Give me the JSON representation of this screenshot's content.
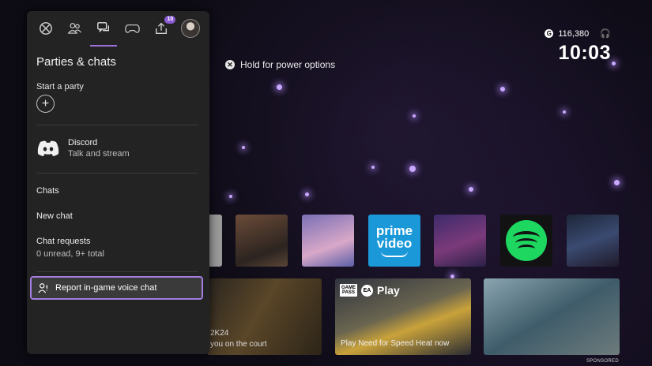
{
  "background": {
    "accent": "#9b6fd9"
  },
  "status": {
    "gamerscore": "116,380",
    "time": "10:03"
  },
  "hints": {
    "power": "Hold for power options"
  },
  "guide": {
    "tabs": [
      {
        "icon": "xbox-icon"
      },
      {
        "icon": "people-icon"
      },
      {
        "icon": "chat-bubbles-icon",
        "active": true
      },
      {
        "icon": "controller-icon"
      },
      {
        "icon": "upload-icon",
        "badge": "10"
      },
      {
        "icon": "profile-avatar"
      }
    ],
    "title": "Parties & chats",
    "start_party_label": "Start a party",
    "discord": {
      "name": "Discord",
      "subtitle": "Talk and stream"
    },
    "chats_label": "Chats",
    "new_chat_label": "New chat",
    "chat_requests": {
      "label": "Chat requests",
      "subtitle": "0 unread, 9+ total"
    },
    "report_label": "Report in-game voice chat"
  },
  "tiles": {
    "prime_video": {
      "line1": "prime",
      "line2": "video"
    }
  },
  "cards": {
    "nba": {
      "line1": "2K24",
      "line2": "you on the court"
    },
    "gamepass": {
      "badge_line1": "GAME",
      "badge_line2": "PASS",
      "ea": "EA",
      "play": "Play",
      "caption": "Play Need for Speed Heat now"
    },
    "sponsored": "SPONSORED"
  }
}
